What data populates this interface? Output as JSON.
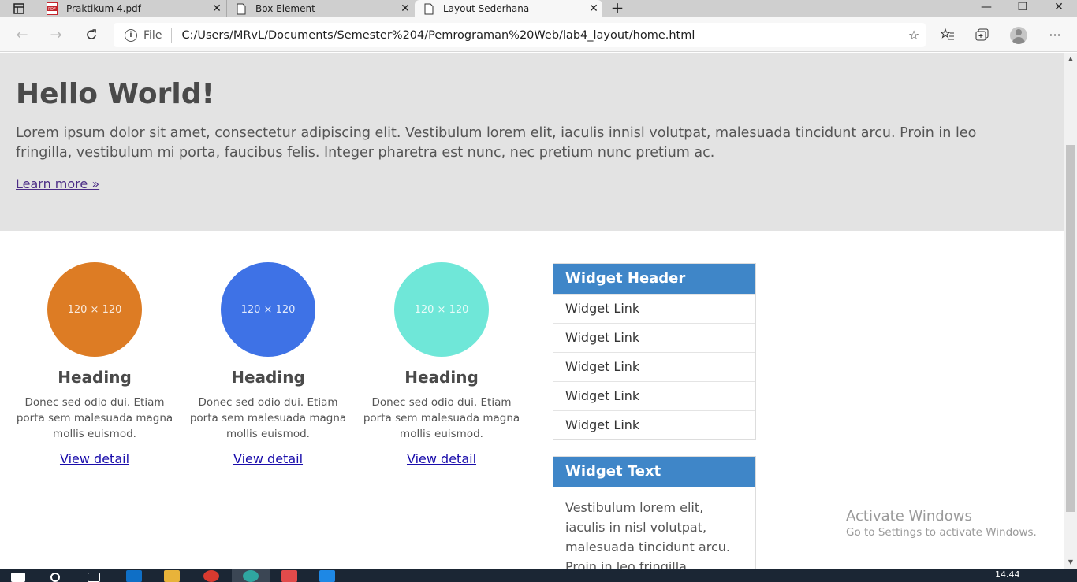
{
  "browser": {
    "tabs": [
      {
        "title": "Praktikum 4.pdf",
        "icon": "pdf-icon"
      },
      {
        "title": "Box Element",
        "icon": "page-icon"
      },
      {
        "title": "Layout Sederhana",
        "icon": "page-icon",
        "active": true
      }
    ],
    "address": {
      "scheme": "File",
      "url": "C:/Users/MRvL/Documents/Semester%204/Pemrograman%20Web/lab4_layout/home.html"
    }
  },
  "hero": {
    "title": "Hello World!",
    "body": "Lorem ipsum dolor sit amet, consectetur adipiscing elit. Vestibulum lorem elit, iaculis innisl volutpat, malesuada tincidunt arcu. Proin in leo fringilla, vestibulum mi porta, faucibus felis. Integer pharetra est nunc, nec pretium nunc pretium ac.",
    "link": "Learn more »"
  },
  "columns": [
    {
      "placeholder": "120 × 120",
      "color": "#dd7c24",
      "heading": "Heading",
      "text": "Donec sed odio dui. Etiam porta sem malesuada magna mollis euismod.",
      "link": "View detail"
    },
    {
      "placeholder": "120 × 120",
      "color": "#3e72e6",
      "heading": "Heading",
      "text": "Donec sed odio dui. Etiam porta sem malesuada magna mollis euismod.",
      "link": "View detail"
    },
    {
      "placeholder": "120 × 120",
      "color": "#6fe7d8",
      "heading": "Heading",
      "text": "Donec sed odio dui. Etiam porta sem malesuada magna mollis euismod.",
      "link": "View detail"
    }
  ],
  "widget_links": {
    "header": "Widget Header",
    "links": [
      "Widget Link",
      "Widget Link",
      "Widget Link",
      "Widget Link",
      "Widget Link"
    ]
  },
  "widget_text": {
    "header": "Widget Text",
    "body": "Vestibulum lorem elit, iaculis in nisl volutpat, malesuada tincidunt arcu. Proin in leo fringilla, vestibulum mi porta"
  },
  "watermark": {
    "line1": "Activate Windows",
    "line2": "Go to Settings to activate Windows."
  },
  "taskbar": {
    "time": "14.44"
  },
  "colors": {
    "widget_header": "#3f86c8",
    "hero_bg": "#e3e3e3"
  }
}
